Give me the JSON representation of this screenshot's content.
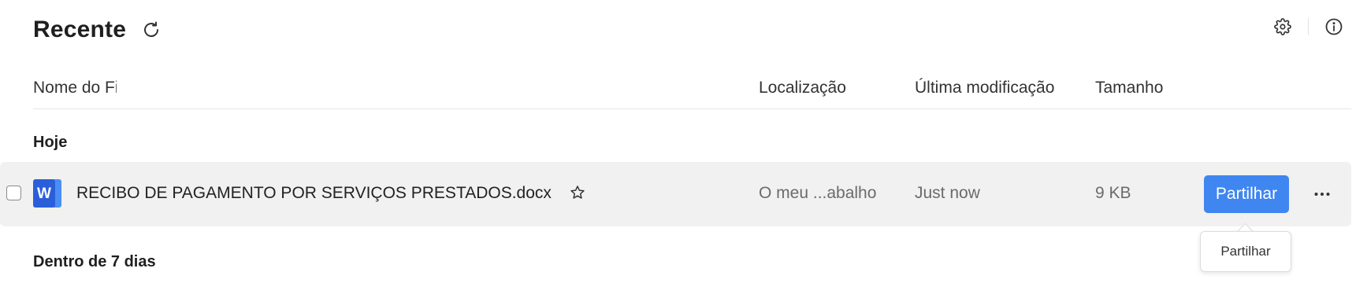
{
  "header": {
    "title": "Recente",
    "refresh_icon": "refresh-icon"
  },
  "top_actions": {
    "settings_icon": "gear-icon",
    "info_icon": "info-icon"
  },
  "columns": {
    "name": "Nome do Fi",
    "location": "Localização",
    "modified": "Última modificação",
    "size": "Tamanho"
  },
  "groups": {
    "today": "Hoje",
    "week": "Dentro de 7 dias"
  },
  "files": [
    {
      "name": "RECIBO DE PAGAMENTO POR SERVIÇOS PRESTADOS.docx",
      "icon": "word-icon",
      "icon_letter": "W",
      "location": "O meu ...abalho",
      "modified": "Just now",
      "size": "9 KB",
      "share_label": "Partilhar"
    }
  ],
  "tooltip": {
    "text": "Partilhar"
  },
  "colors": {
    "accent": "#3f86f0",
    "row_highlight": "#f1f1f1",
    "word_blue": "#2b5fd9"
  }
}
